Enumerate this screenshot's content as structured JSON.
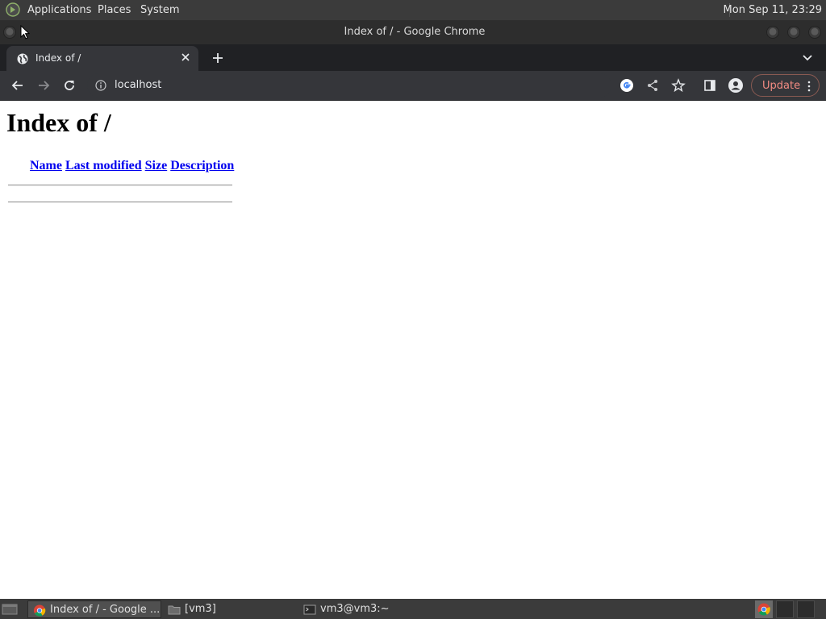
{
  "system_panel": {
    "menus": [
      "Applications",
      "Places",
      "System"
    ],
    "clock": "Mon Sep 11, 23:29"
  },
  "window": {
    "title": "Index of / - Google Chrome"
  },
  "tabs": [
    {
      "title": "Index of /",
      "active": true
    }
  ],
  "toolbar": {
    "url": "localhost",
    "update_label": "Update"
  },
  "page": {
    "heading": "Index of /",
    "columns": [
      "Name",
      "Last modified",
      "Size",
      "Description"
    ]
  },
  "taskbar": {
    "tasks": [
      {
        "label": "Index of / - Google ...",
        "icon": "chrome-icon",
        "active": true
      },
      {
        "label": "[vm3]",
        "icon": "folder-icon",
        "active": false
      },
      {
        "label": "vm3@vm3:~",
        "icon": "terminal-icon",
        "active": false
      }
    ]
  },
  "colors": {
    "panel_bg": "#3b3b3b",
    "tabstrip_bg": "#202124",
    "toolbar_bg": "#35363a",
    "link": "#0000ee",
    "update_accent": "#f28b82"
  }
}
